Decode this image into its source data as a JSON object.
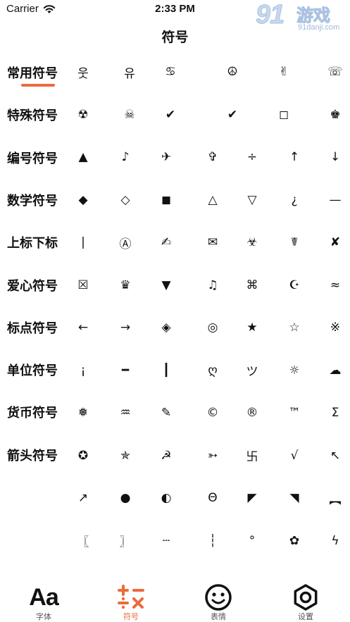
{
  "status_bar": {
    "carrier": "Carrier",
    "time": "2:33 PM"
  },
  "watermark": {
    "big": "91",
    "cn": "游戏",
    "url": "91danji.com"
  },
  "nav": {
    "title": "符号"
  },
  "categories": [
    {
      "label": "常用符号",
      "selected": true
    },
    {
      "label": "特殊符号",
      "selected": false
    },
    {
      "label": "编号符号",
      "selected": false
    },
    {
      "label": "数学符号",
      "selected": false
    },
    {
      "label": "上标下标",
      "selected": false
    },
    {
      "label": "爱心符号",
      "selected": false
    },
    {
      "label": "标点符号",
      "selected": false
    },
    {
      "label": "单位符号",
      "selected": false
    },
    {
      "label": "货币符号",
      "selected": false
    },
    {
      "label": "箭头符号",
      "selected": false
    }
  ],
  "symbol_rows": [
    [
      "웃",
      "유",
      "♋",
      "☮",
      "✌",
      "☏"
    ],
    [
      "☢",
      "☠",
      "✔",
      "✔",
      "◻",
      "♚"
    ],
    [
      "▲",
      "♪",
      "✈",
      "✞",
      "÷",
      "↑",
      "↓"
    ],
    [
      "◆",
      "◇",
      "◼",
      "△",
      "▽",
      "¿",
      "—"
    ],
    [
      "|",
      "Ⓐ",
      "✍",
      "✉",
      "☣",
      "☤",
      "✘"
    ],
    [
      "☒",
      "♛",
      "▼",
      "♫",
      "⌘",
      "☪",
      "≈"
    ],
    [
      "←",
      "→",
      "◈",
      "◎",
      "★",
      "☆",
      "※"
    ],
    [
      "¡",
      "━",
      "┃",
      "ღ",
      "ツ",
      "☼",
      "☁"
    ],
    [
      "❅",
      "♒",
      "✎",
      "©",
      "®",
      "™",
      "Σ"
    ],
    [
      "✪",
      "✯",
      "☭",
      "➳",
      "卐",
      "√",
      "↖"
    ],
    [
      "↗",
      "●",
      "◐",
      "Θ",
      "◤",
      "◥",
      "︻"
    ],
    [
      "〖",
      "〗",
      "┄",
      "┆",
      "°",
      "✿",
      "ϟ"
    ]
  ],
  "tabs": [
    {
      "label": "字体",
      "icon": "font-icon",
      "glyph": "Aa",
      "active": false
    },
    {
      "label": "符号",
      "icon": "math-symbols-icon",
      "active": true
    },
    {
      "label": "表情",
      "icon": "smiley-icon",
      "active": false
    },
    {
      "label": "设置",
      "icon": "settings-hex-icon",
      "active": false
    }
  ],
  "colors": {
    "accent": "#ec6b3c",
    "text": "#111111",
    "background": "#ffffff"
  }
}
